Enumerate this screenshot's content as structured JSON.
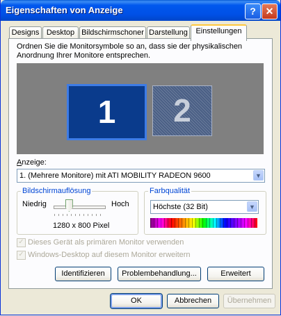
{
  "window": {
    "title": "Eigenschaften von Anzeige"
  },
  "titlebar": {
    "help_glyph": "?",
    "close_glyph": "✕"
  },
  "tabs": [
    {
      "label": "Designs",
      "active": false
    },
    {
      "label": "Desktop",
      "active": false
    },
    {
      "label": "Bildschirmschoner",
      "active": false
    },
    {
      "label": "Darstellung",
      "active": false
    },
    {
      "label": "Einstellungen",
      "active": true
    }
  ],
  "instructions": "Ordnen Sie die Monitorsymbole so an, dass sie der physikalischen Anordnung Ihrer Monitore entsprechen.",
  "monitors": [
    {
      "number": "1",
      "selected": true
    },
    {
      "number": "2",
      "selected": false
    }
  ],
  "display": {
    "label": "Anzeige:",
    "selected": "1. (Mehrere Monitore) mit ATI MOBILITY RADEON 9600"
  },
  "resolution": {
    "group_label": "Bildschirmauflösung",
    "low_label": "Niedrig",
    "high_label": "Hoch",
    "value": "1280 x 800 Pixel",
    "slider_level": 0.3
  },
  "color_quality": {
    "group_label": "Farbqualität",
    "selected": "Höchste (32 Bit)"
  },
  "checkboxes": [
    {
      "label": "Dieses Gerät als primären Monitor verwenden",
      "checked": true,
      "enabled": false
    },
    {
      "label": "Windows-Desktop auf diesem Monitor erweitern",
      "checked": true,
      "enabled": false
    }
  ],
  "panel_buttons": {
    "identify": "Identifizieren",
    "troubleshoot": "Problembehandlung...",
    "advanced": "Erweitert"
  },
  "dialog_buttons": {
    "ok": "OK",
    "cancel": "Abbrechen",
    "apply": "Übernehmen"
  },
  "colors": {
    "titlebar": "#0054e3",
    "group_label": "#0046d5",
    "monitor_selected": "#0a3b8c",
    "preview_bg": "#808080"
  }
}
